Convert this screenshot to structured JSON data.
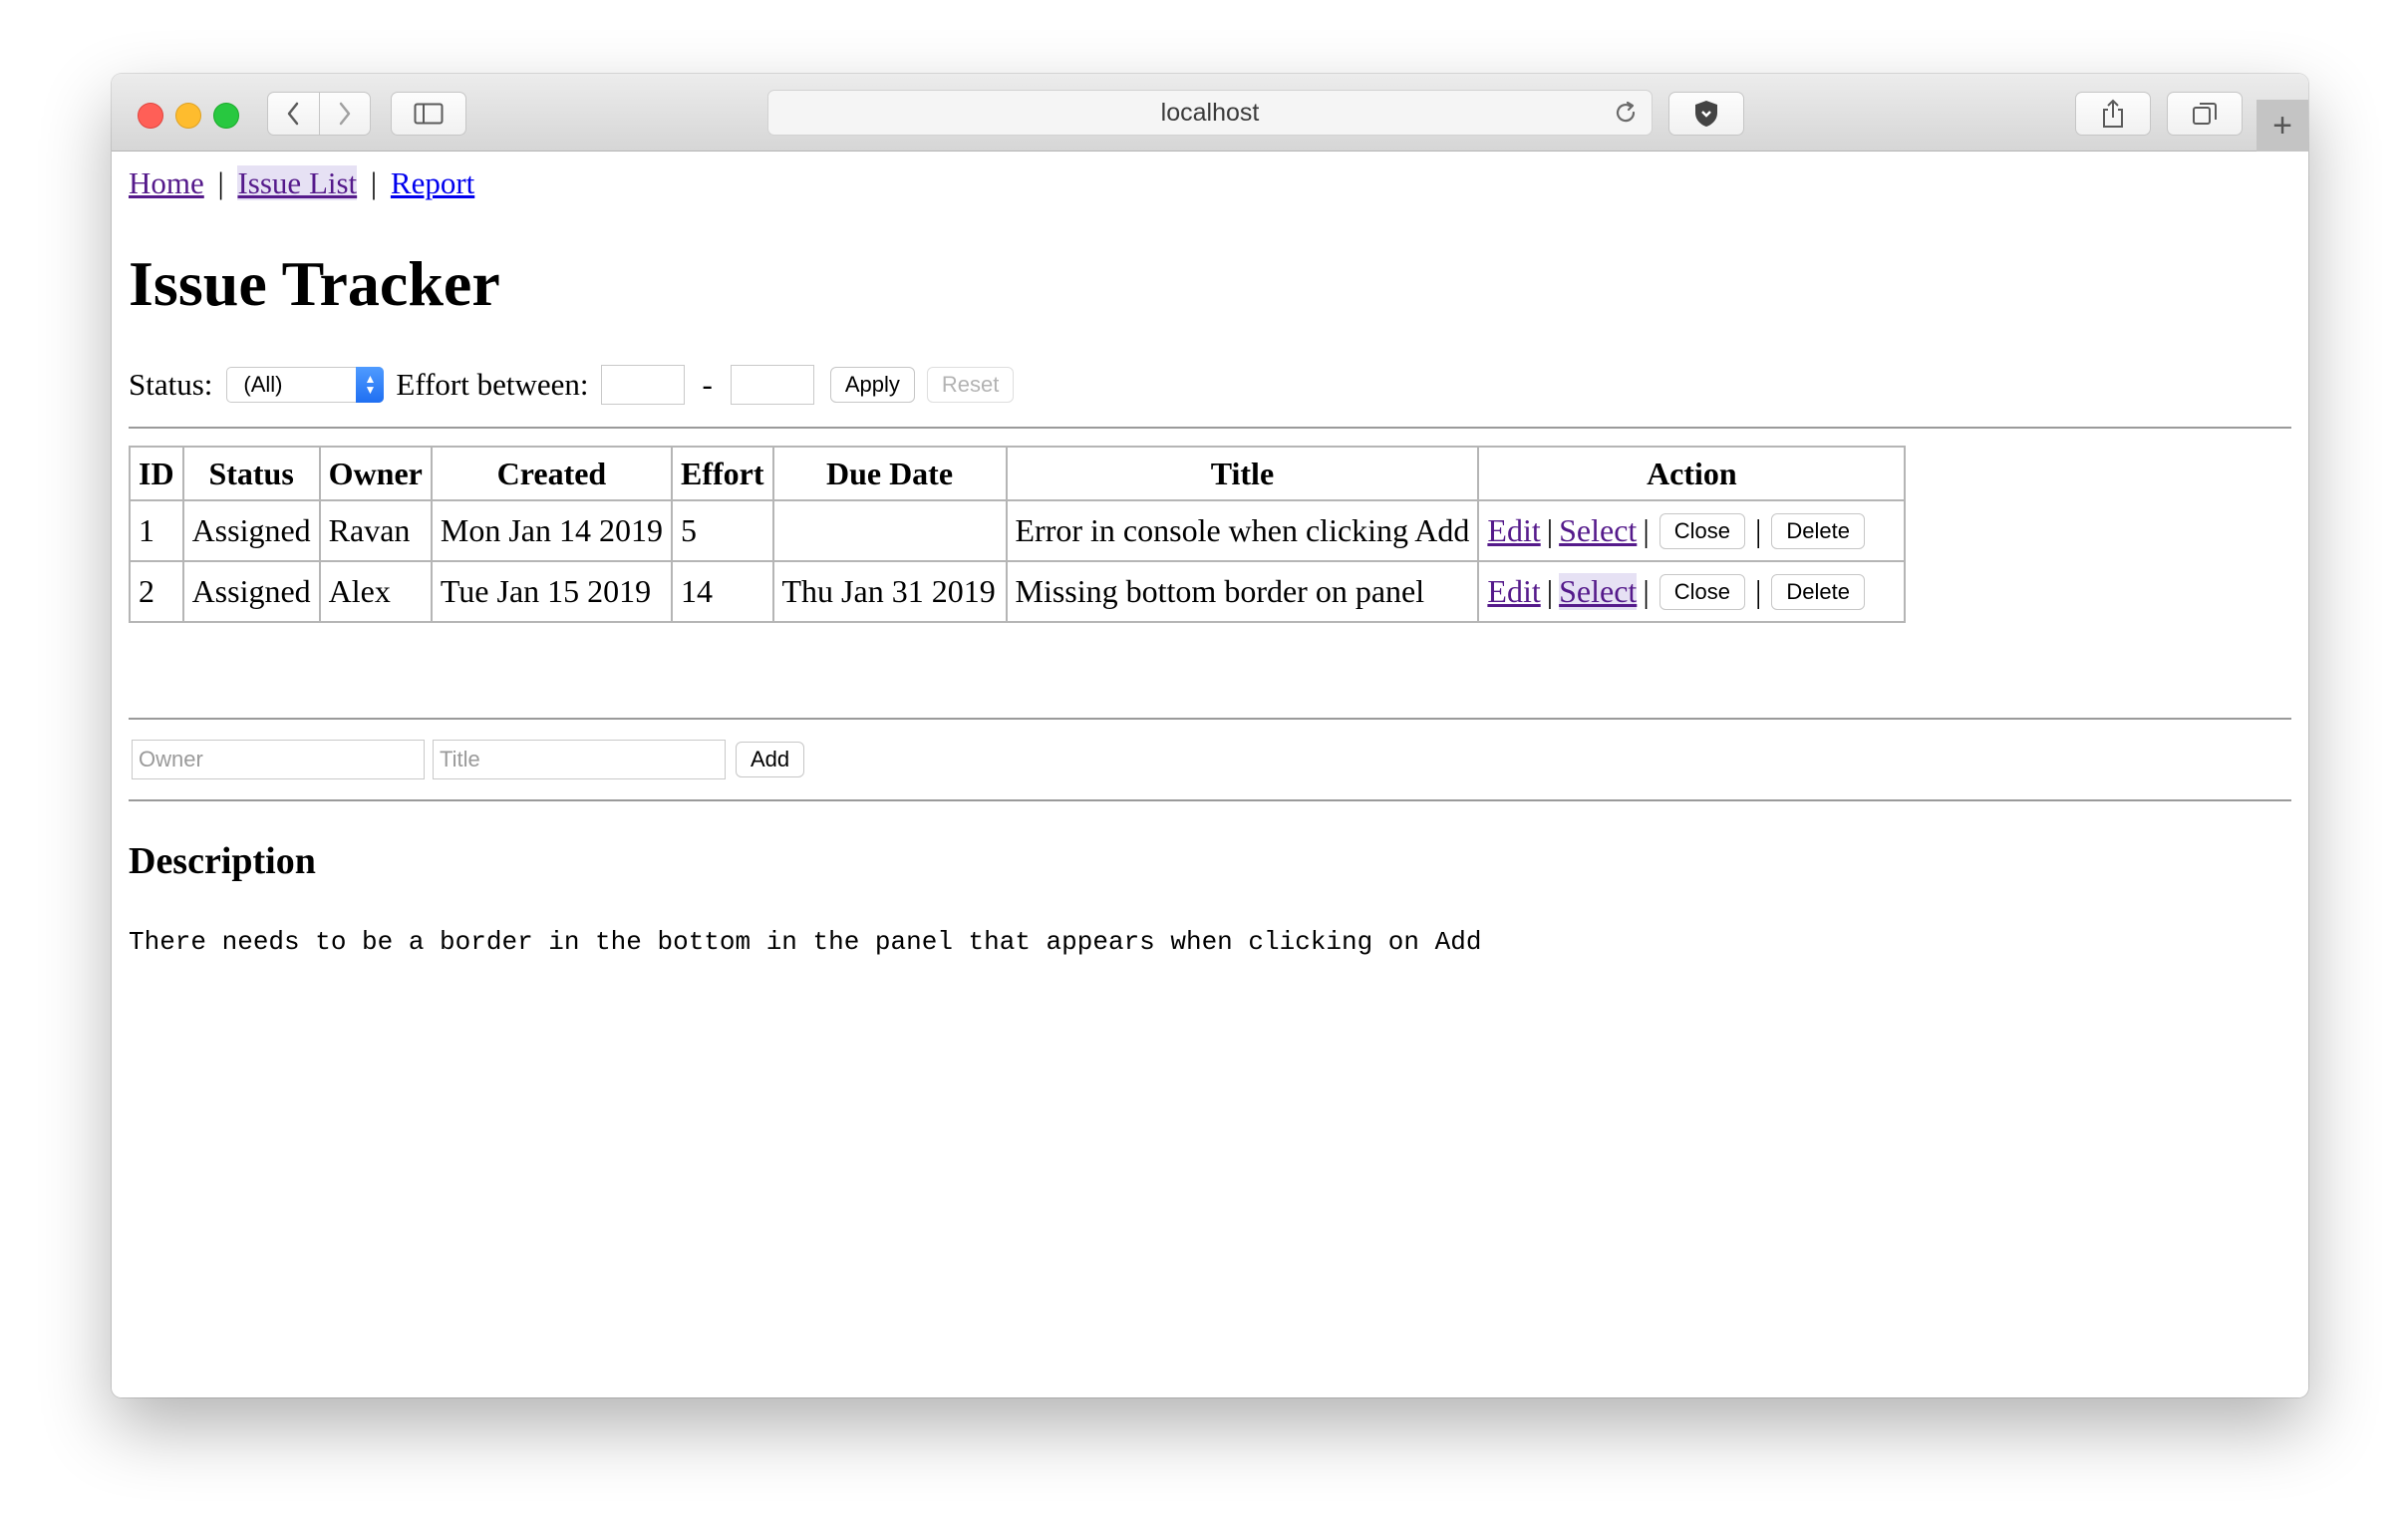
{
  "browser": {
    "url": "localhost"
  },
  "nav": {
    "home": "Home",
    "issue_list": "Issue List",
    "report": "Report",
    "separator": "|"
  },
  "page": {
    "title": "Issue Tracker"
  },
  "filter": {
    "status_label": "Status:",
    "status_value": "(All)",
    "effort_label": "Effort between:",
    "effort_min": "",
    "effort_max": "",
    "range_dash": "-",
    "apply_label": "Apply",
    "reset_label": "Reset"
  },
  "table": {
    "headers": [
      "ID",
      "Status",
      "Owner",
      "Created",
      "Effort",
      "Due Date",
      "Title",
      "Action"
    ],
    "rows": [
      {
        "id": "1",
        "status": "Assigned",
        "owner": "Ravan",
        "created": "Mon Jan 14 2019",
        "effort": "5",
        "due": "",
        "title": "Error in console when clicking Add"
      },
      {
        "id": "2",
        "status": "Assigned",
        "owner": "Alex",
        "created": "Tue Jan 15 2019",
        "effort": "14",
        "due": "Thu Jan 31 2019",
        "title": "Missing bottom border on panel"
      }
    ],
    "actions": {
      "edit": "Edit",
      "select": "Select",
      "close": "Close",
      "delete": "Delete",
      "separator": "|"
    }
  },
  "add_form": {
    "owner_placeholder": "Owner",
    "title_placeholder": "Title",
    "add_label": "Add"
  },
  "description": {
    "heading": "Description",
    "text": "There needs to be a border in the bottom in the panel that appears when clicking on Add"
  }
}
